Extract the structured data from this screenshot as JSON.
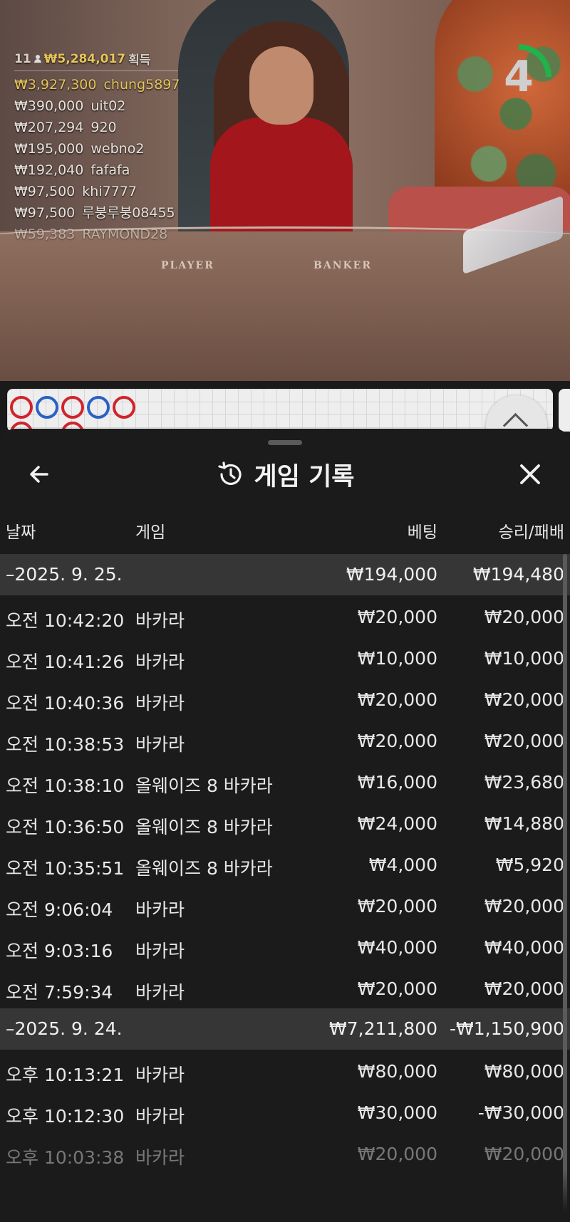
{
  "stream": {
    "timer_value": "4",
    "table_labels": [
      "PLAYER",
      "BANKER"
    ],
    "winners": {
      "count": "11",
      "total": "₩5,284,017",
      "total_suffix": "획득",
      "list": [
        {
          "amount": "₩3,927,300",
          "name": "chung5897"
        },
        {
          "amount": "₩390,000",
          "name": "uit02"
        },
        {
          "amount": "₩207,294",
          "name": "920"
        },
        {
          "amount": "₩195,000",
          "name": "webno2"
        },
        {
          "amount": "₩192,040",
          "name": "fafafa"
        },
        {
          "amount": "₩97,500",
          "name": "khi7777"
        },
        {
          "amount": "₩97,500",
          "name": "루붕루붕08455"
        },
        {
          "amount": "₩59,383",
          "name": "RAYMOND28"
        }
      ]
    }
  },
  "roadmap": {
    "cells": [
      {
        "row": 0,
        "col": 0,
        "color": "red"
      },
      {
        "row": 0,
        "col": 1,
        "color": "blue"
      },
      {
        "row": 0,
        "col": 2,
        "color": "red"
      },
      {
        "row": 0,
        "col": 3,
        "color": "blue"
      },
      {
        "row": 0,
        "col": 4,
        "color": "red"
      },
      {
        "row": 1,
        "col": 0,
        "color": "red"
      },
      {
        "row": 1,
        "col": 2,
        "color": "red"
      }
    ]
  },
  "history": {
    "title": "게임 기록",
    "columns": {
      "date": "날짜",
      "game": "게임",
      "bet": "베팅",
      "winloss": "승리/패배"
    },
    "groups": [
      {
        "date": "–2025. 9. 25.",
        "bet_total": "₩194,000",
        "winloss_total": "₩194,480",
        "rows": [
          {
            "time": "오전 10:42:20",
            "game": "바카라",
            "bet": "₩20,000",
            "winloss": "₩20,000"
          },
          {
            "time": "오전 10:41:26",
            "game": "바카라",
            "bet": "₩10,000",
            "winloss": "₩10,000"
          },
          {
            "time": "오전 10:40:36",
            "game": "바카라",
            "bet": "₩20,000",
            "winloss": "₩20,000"
          },
          {
            "time": "오전 10:38:53",
            "game": "바카라",
            "bet": "₩20,000",
            "winloss": "₩20,000"
          },
          {
            "time": "오전 10:38:10",
            "game": "올웨이즈 8 바카라",
            "bet": "₩16,000",
            "winloss": "₩23,680"
          },
          {
            "time": "오전 10:36:50",
            "game": "올웨이즈 8 바카라",
            "bet": "₩24,000",
            "winloss": "₩14,880"
          },
          {
            "time": "오전 10:35:51",
            "game": "올웨이즈 8 바카라",
            "bet": "₩4,000",
            "winloss": "₩5,920"
          },
          {
            "time": "오전 9:06:04",
            "game": "바카라",
            "bet": "₩20,000",
            "winloss": "₩20,000"
          },
          {
            "time": "오전 9:03:16",
            "game": "바카라",
            "bet": "₩40,000",
            "winloss": "₩40,000"
          },
          {
            "time": "오전 7:59:34",
            "game": "바카라",
            "bet": "₩20,000",
            "winloss": "₩20,000"
          }
        ]
      },
      {
        "date": "–2025. 9. 24.",
        "bet_total": "₩7,211,800",
        "winloss_total": "-₩1,150,900",
        "rows": [
          {
            "time": "오후 10:13:21",
            "game": "바카라",
            "bet": "₩80,000",
            "winloss": "₩80,000"
          },
          {
            "time": "오후 10:12:30",
            "game": "바카라",
            "bet": "₩30,000",
            "winloss": "-₩30,000"
          },
          {
            "time": "오후 10:03:38",
            "game": "바카라",
            "bet": "₩20,000",
            "winloss": "₩20,000"
          }
        ]
      }
    ]
  }
}
